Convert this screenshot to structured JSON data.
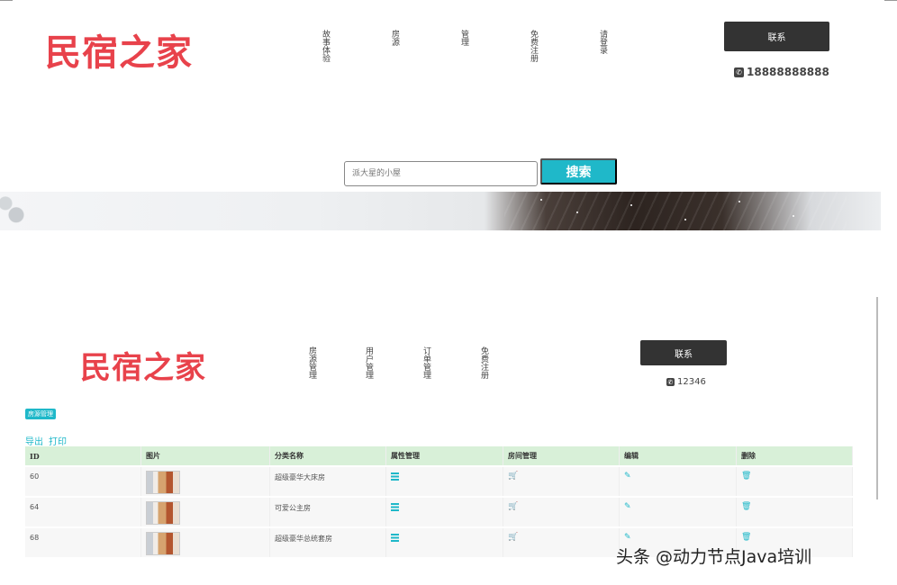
{
  "top": {
    "logo": "民宿之家",
    "nav": [
      "故事体验",
      "房源",
      "管理",
      "免费注册",
      "请登录"
    ],
    "contact_label": "联系",
    "phone": "18888888888",
    "search": {
      "placeholder": "派大星的小屋",
      "button": "搜索"
    }
  },
  "bottom": {
    "logo": "民宿之家",
    "nav": [
      "房源管理",
      "用户管理",
      "订单管理",
      "免费注册"
    ],
    "contact_label": "联系",
    "phone": "12346",
    "tag": "房源管理",
    "links": [
      "导出",
      "打印"
    ],
    "table": {
      "headers": [
        "ID",
        "图片",
        "分类名称",
        "属性管理",
        "房间管理",
        "编辑",
        "删除"
      ],
      "rows": [
        {
          "id": "60",
          "name": "超级豪华大床房"
        },
        {
          "id": "64",
          "name": "可爱公主房"
        },
        {
          "id": "68",
          "name": "超级豪华总统套房"
        }
      ]
    }
  },
  "watermark": "头条 @动力节点Java培训",
  "icons": [
    "phone-icon",
    "list-icon",
    "cart-icon",
    "edit-icon",
    "trash-icon"
  ],
  "colors": {
    "brand": "#e8424b",
    "accent": "#1fb8c9",
    "header_row": "#d8f0d8"
  }
}
